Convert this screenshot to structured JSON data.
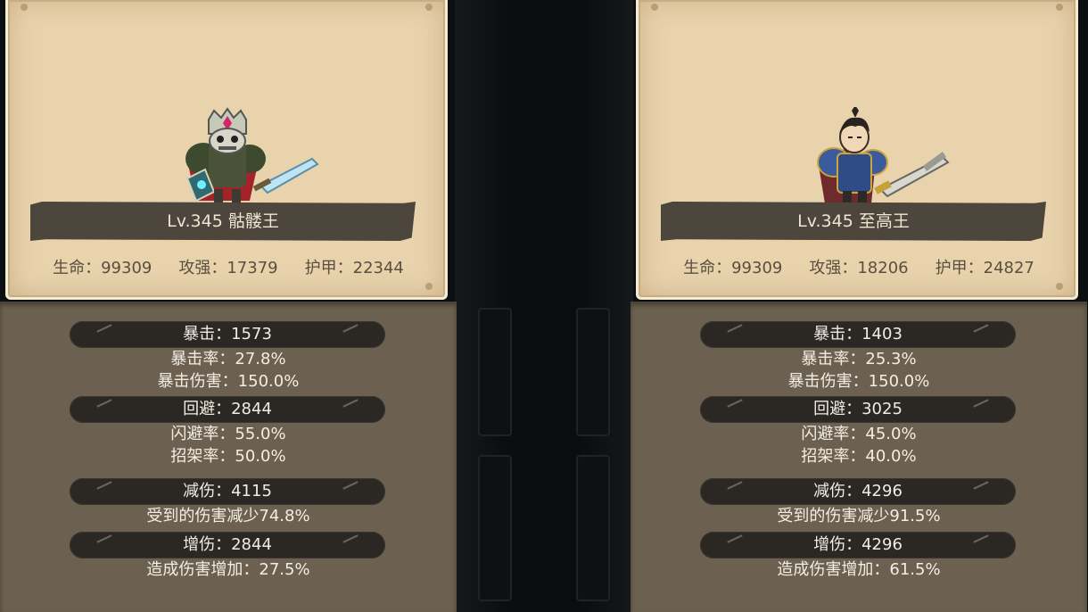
{
  "left": {
    "name": "Lv.345 骷髅王",
    "hp": "生命：99309",
    "atk": "攻强：17379",
    "armor": "护甲：22344",
    "crit": "暴击：1573",
    "crit_rate": "暴击率：27.8%",
    "crit_dmg": "暴击伤害：150.0%",
    "dodge": "回避：2844",
    "evade_rate": "闪避率：55.0%",
    "parry_rate": "招架率：50.0%",
    "dmg_reduce": "减伤：4115",
    "dmg_reduce_desc": "受到的伤害减少74.8%",
    "dmg_boost": "增伤：2844",
    "dmg_boost_desc": "造成伤害增加：27.5%"
  },
  "right": {
    "name": "Lv.345 至高王",
    "hp": "生命：99309",
    "atk": "攻强：18206",
    "armor": "护甲：24827",
    "crit": "暴击：1403",
    "crit_rate": "暴击率：25.3%",
    "crit_dmg": "暴击伤害：150.0%",
    "dodge": "回避：3025",
    "evade_rate": "闪避率：45.0%",
    "parry_rate": "招架率：40.0%",
    "dmg_reduce": "减伤：4296",
    "dmg_reduce_desc": "受到的伤害减少91.5%",
    "dmg_boost": "增伤：4296",
    "dmg_boost_desc": "造成伤害增加：61.5%"
  },
  "colors": {
    "card_bg": "#e8d3ad",
    "pill_bg": "#2b2824",
    "lower_bg": "#6c6150"
  }
}
